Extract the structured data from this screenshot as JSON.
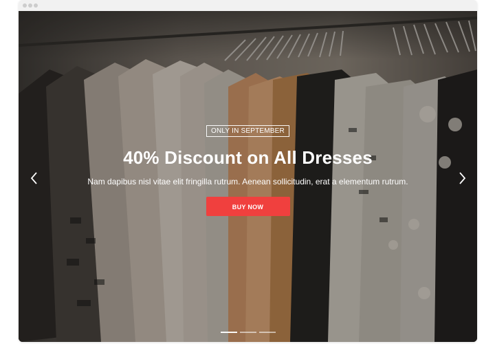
{
  "slide": {
    "badge": "ONLY IN SEPTEMBER",
    "headline": "40% Discount on All Dresses",
    "description": "Nam dapibus nisl vitae elit fringilla rutrum. Aenean sollicitudin, erat a elementum rutrum.",
    "cta_label": "BUY NOW"
  },
  "icons": {
    "prev": "chevron-left-icon",
    "next": "chevron-right-icon"
  },
  "indicators": {
    "count": 3,
    "active_index": 0
  },
  "colors": {
    "cta": "#f0403e",
    "text": "#ffffff"
  }
}
